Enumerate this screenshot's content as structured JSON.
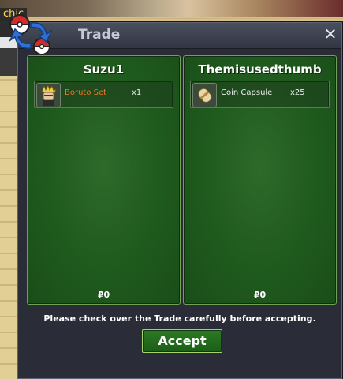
{
  "background": {
    "player_label": "chic"
  },
  "window": {
    "title": "Trade",
    "close_glyph": "✕"
  },
  "left_panel": {
    "player": "Suzu1",
    "items": [
      {
        "icon": "boruto-set-icon",
        "name": "Boruto Set",
        "qty": "x1",
        "name_color": "#e8762a"
      }
    ],
    "money": "₽0"
  },
  "right_panel": {
    "player": "Themisusedthumb",
    "items": [
      {
        "icon": "coin-capsule-icon",
        "name": "Coin Capsule",
        "qty": "x25",
        "name_color": "#e9eee7"
      }
    ],
    "money": "₽0"
  },
  "notice": "Please check over the Trade carefully before accepting.",
  "accept_label": "Accept"
}
